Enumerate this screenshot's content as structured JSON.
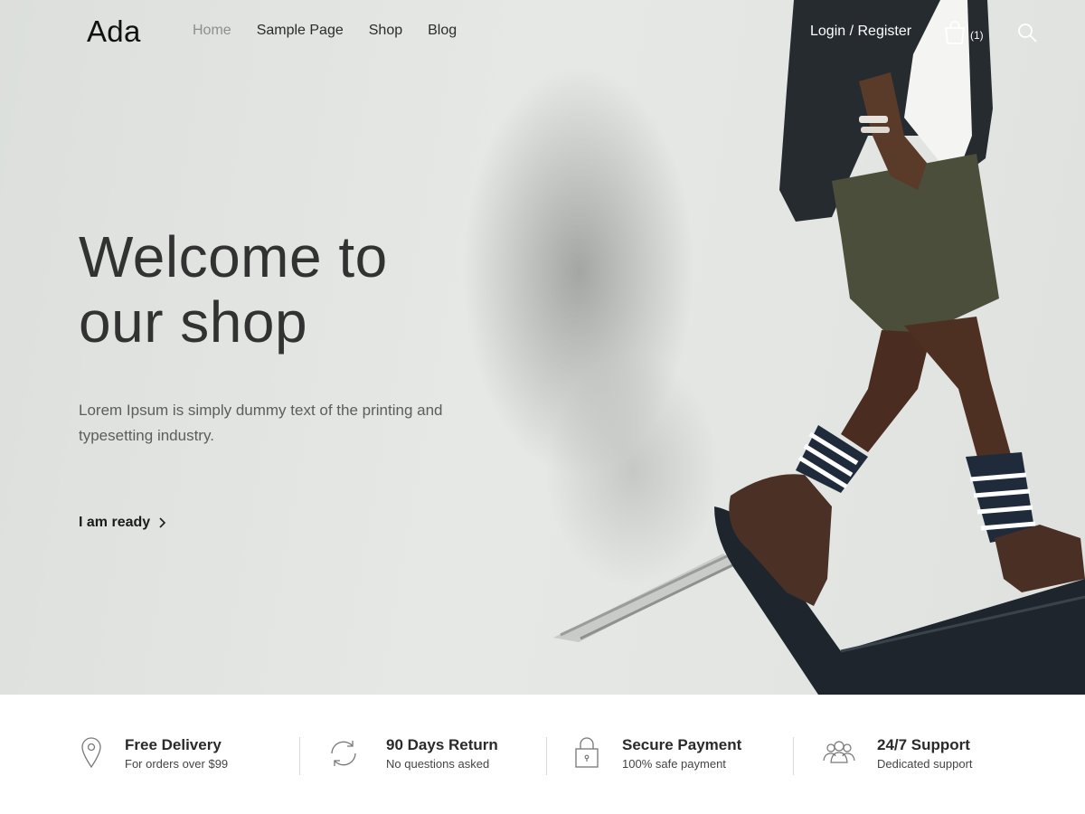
{
  "header": {
    "logo": "Ada",
    "nav": [
      "Home",
      "Sample Page",
      "Shop",
      "Blog"
    ],
    "active_nav": "Home",
    "login_label": "Login / Register",
    "cart_count": "(1)"
  },
  "hero": {
    "title_line1": "Welcome to",
    "title_line2": "our shop",
    "description": "Lorem Ipsum is simply dummy text of the printing and typesetting industry.",
    "cta_label": "I am ready"
  },
  "features": [
    {
      "icon": "map-pin-icon",
      "title": "Free Delivery",
      "subtitle": "For orders over $99"
    },
    {
      "icon": "refresh-icon",
      "title": "90 Days Return",
      "subtitle": "No questions asked"
    },
    {
      "icon": "lock-icon",
      "title": "Secure Payment",
      "subtitle": "100% safe payment"
    },
    {
      "icon": "users-icon",
      "title": "24/7 Support",
      "subtitle": "Dedicated support"
    }
  ],
  "colors": {
    "hero_bg": "#e2e4e2",
    "text_dark": "#2a2a2a",
    "nav_active": "#8d8f8d"
  }
}
